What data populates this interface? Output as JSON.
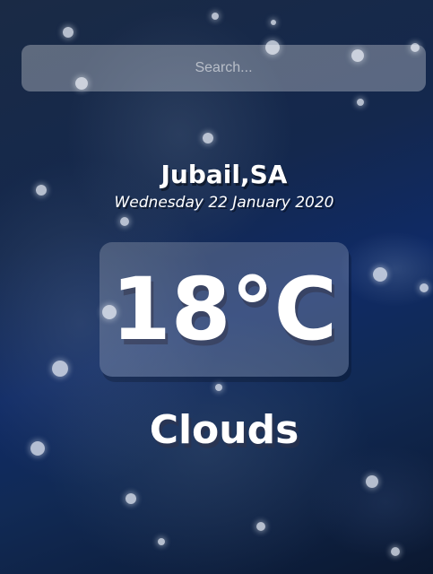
{
  "search": {
    "placeholder": "Search..."
  },
  "location": {
    "city": "Jubail,SA",
    "date": "Wednesday 22 January 2020"
  },
  "weather": {
    "temperature": "18°C",
    "condition": "Clouds"
  }
}
